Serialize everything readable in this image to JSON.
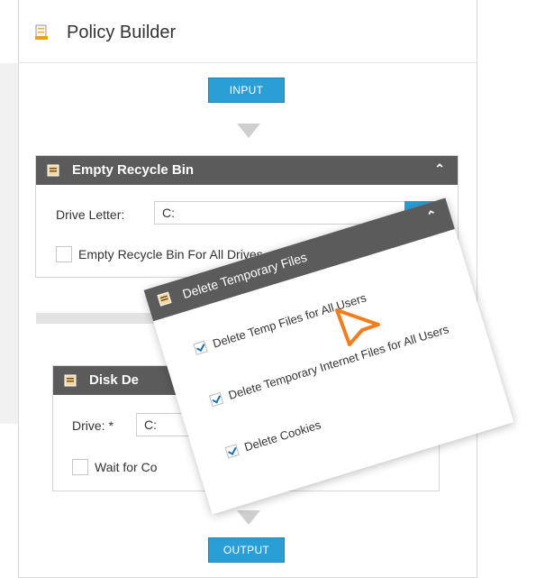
{
  "header": {
    "title": "Policy Builder",
    "icon": "document-icon"
  },
  "flow": {
    "input_label": "INPUT",
    "output_label": "OUTPUT"
  },
  "empty_recycle_bin": {
    "title": "Empty Recycle Bin",
    "drive_letter_label": "Drive Letter:",
    "drive_letter_value": "C:",
    "all_drives_label": "Empty Recycle Bin For All Drives",
    "all_drives_checked": false
  },
  "disk_defrag": {
    "title_visible": "Disk De",
    "drive_label": "Drive: *",
    "drive_value": "C:",
    "wait_label_visible": "Wait for Co"
  },
  "delete_temp_files": {
    "title": "Delete Temporary Files",
    "options": [
      {
        "label": "Delete Temp Files for All Users",
        "checked": true
      },
      {
        "label": "Delete Temporary Internet Files for All Users",
        "checked": true
      },
      {
        "label": "Delete Cookies",
        "checked": true
      }
    ]
  },
  "colors": {
    "accent": "#2a9fd6",
    "block_header": "#5b5b5b",
    "cursor": "#f07d1e"
  }
}
